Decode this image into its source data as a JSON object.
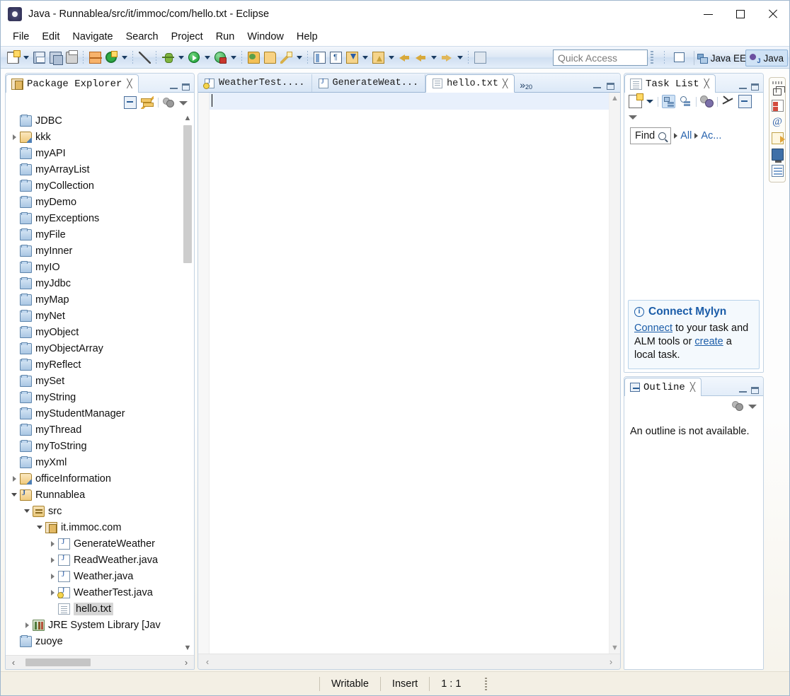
{
  "window": {
    "title": "Java - Runnablea/src/it/immoc/com/hello.txt - Eclipse",
    "app_icon": "eclipse-icon",
    "minimize": "minimize-button",
    "maximize": "maximize-button",
    "close": "close-button"
  },
  "menubar": {
    "items": [
      "File",
      "Edit",
      "Navigate",
      "Search",
      "Project",
      "Run",
      "Window",
      "Help"
    ]
  },
  "toolbar": {
    "quick_access_placeholder": "Quick Access",
    "perspectives": [
      {
        "label": "Java EE",
        "active": false
      },
      {
        "label": "Java",
        "active": true
      }
    ],
    "buttons": [
      "new-wizard",
      "save",
      "save-all",
      "print",
      "new-java-project",
      "refresh-external",
      "toggle-mark-occurrences",
      "debug",
      "run",
      "run-external-tools",
      "new-java-package",
      "open-type",
      "quick-access-wand",
      "toggle-block-selection",
      "show-whitespace",
      "next-annotation",
      "previous-annotation",
      "back",
      "forward",
      "pin-editor"
    ]
  },
  "package_explorer": {
    "title": "Package Explorer",
    "close_glyph": "╳",
    "toolbar": [
      "collapse-all",
      "link-with-editor",
      "focus-on-active-task",
      "view-menu"
    ],
    "tree": [
      {
        "label": "JDBC",
        "icon": "folder",
        "indent": 1,
        "twisty": "none",
        "selected": false
      },
      {
        "label": "kkk",
        "icon": "project",
        "indent": 1,
        "twisty": "closed",
        "selected": false
      },
      {
        "label": "myAPI",
        "icon": "folder",
        "indent": 1,
        "twisty": "none",
        "selected": false
      },
      {
        "label": "myArrayList",
        "icon": "folder",
        "indent": 1,
        "twisty": "none",
        "selected": false
      },
      {
        "label": "myCollection",
        "icon": "folder",
        "indent": 1,
        "twisty": "none",
        "selected": false
      },
      {
        "label": "myDemo",
        "icon": "folder",
        "indent": 1,
        "twisty": "none",
        "selected": false
      },
      {
        "label": "myExceptions",
        "icon": "folder",
        "indent": 1,
        "twisty": "none",
        "selected": false
      },
      {
        "label": "myFile",
        "icon": "folder",
        "indent": 1,
        "twisty": "none",
        "selected": false
      },
      {
        "label": "myInner",
        "icon": "folder",
        "indent": 1,
        "twisty": "none",
        "selected": false
      },
      {
        "label": "myIO",
        "icon": "folder",
        "indent": 1,
        "twisty": "none",
        "selected": false
      },
      {
        "label": "myJdbc",
        "icon": "folder",
        "indent": 1,
        "twisty": "none",
        "selected": false
      },
      {
        "label": "myMap",
        "icon": "folder",
        "indent": 1,
        "twisty": "none",
        "selected": false
      },
      {
        "label": "myNet",
        "icon": "folder",
        "indent": 1,
        "twisty": "none",
        "selected": false
      },
      {
        "label": "myObject",
        "icon": "folder",
        "indent": 1,
        "twisty": "none",
        "selected": false
      },
      {
        "label": "myObjectArray",
        "icon": "folder",
        "indent": 1,
        "twisty": "none",
        "selected": false
      },
      {
        "label": "myReflect",
        "icon": "folder",
        "indent": 1,
        "twisty": "none",
        "selected": false
      },
      {
        "label": "mySet",
        "icon": "folder",
        "indent": 1,
        "twisty": "none",
        "selected": false
      },
      {
        "label": "myString",
        "icon": "folder",
        "indent": 1,
        "twisty": "none",
        "selected": false
      },
      {
        "label": "myStudentManager",
        "icon": "folder",
        "indent": 1,
        "twisty": "none",
        "selected": false
      },
      {
        "label": "myThread",
        "icon": "folder",
        "indent": 1,
        "twisty": "none",
        "selected": false
      },
      {
        "label": "myToString",
        "icon": "folder",
        "indent": 1,
        "twisty": "none",
        "selected": false
      },
      {
        "label": "myXml",
        "icon": "folder",
        "indent": 1,
        "twisty": "none",
        "selected": false
      },
      {
        "label": "officeInformation",
        "icon": "project",
        "indent": 1,
        "twisty": "closed",
        "selected": false
      },
      {
        "label": "Runnablea",
        "icon": "projectj",
        "indent": 1,
        "twisty": "open",
        "selected": false
      },
      {
        "label": "src",
        "icon": "src",
        "indent": 2,
        "twisty": "open",
        "selected": false
      },
      {
        "label": "it.immoc.com",
        "icon": "pkg",
        "indent": 3,
        "twisty": "open",
        "selected": false
      },
      {
        "label": "GenerateWeather",
        "icon": "java",
        "indent": 4,
        "twisty": "closed",
        "selected": false
      },
      {
        "label": "ReadWeather.java",
        "icon": "java",
        "indent": 4,
        "twisty": "closed",
        "selected": false
      },
      {
        "label": "Weather.java",
        "icon": "java",
        "indent": 4,
        "twisty": "closed",
        "selected": false
      },
      {
        "label": "WeatherTest.java",
        "icon": "javaw",
        "indent": 4,
        "twisty": "closed",
        "selected": false
      },
      {
        "label": "hello.txt",
        "icon": "txt",
        "indent": 4,
        "twisty": "none",
        "selected": true
      },
      {
        "label": "JRE System Library [Jav",
        "icon": "jre",
        "indent": 2,
        "twisty": "closed",
        "selected": false
      },
      {
        "label": "zuoye",
        "icon": "folder",
        "indent": 1,
        "twisty": "none",
        "selected": false
      }
    ]
  },
  "editor": {
    "tabs": [
      {
        "label": "WeatherTest....",
        "icon": "javaw",
        "active": false,
        "closable": false
      },
      {
        "label": "GenerateWeat...",
        "icon": "java",
        "active": false,
        "closable": false
      },
      {
        "label": "hello.txt",
        "icon": "txt",
        "active": true,
        "closable": true
      }
    ],
    "overflow_indicator": "»",
    "overflow_count": "20",
    "close_glyph": "╳",
    "content": ""
  },
  "task_list": {
    "title": "Task List",
    "close_glyph": "╳",
    "find_label": "Find",
    "filters": [
      "All",
      "Ac..."
    ],
    "mylyn": {
      "heading": "Connect Mylyn",
      "link_connect": "Connect",
      "text_middle": " to your task and ALM tools or ",
      "link_create": "create",
      "text_end": " a local task."
    }
  },
  "outline": {
    "title": "Outline",
    "close_glyph": "╳",
    "message": "An outline is not available."
  },
  "fastview": {
    "icons": [
      "restore-view-icon",
      "problems-icon",
      "at-icon",
      "javadoc-icon",
      "console-icon",
      "table-view-icon"
    ]
  },
  "statusbar": {
    "writable": "Writable",
    "insert_mode": "Insert",
    "position": "1 : 1"
  },
  "colors": {
    "accent_blue": "#1a5ca8",
    "link_blue": "#2662ad",
    "toolbar_gradient_top": "#f3f7fc",
    "toolbar_gradient_bottom": "#e4eefa",
    "selection_gray": "#d5d5d5",
    "current_line": "#e8f0fc",
    "status_bg": "#f3efe4"
  }
}
